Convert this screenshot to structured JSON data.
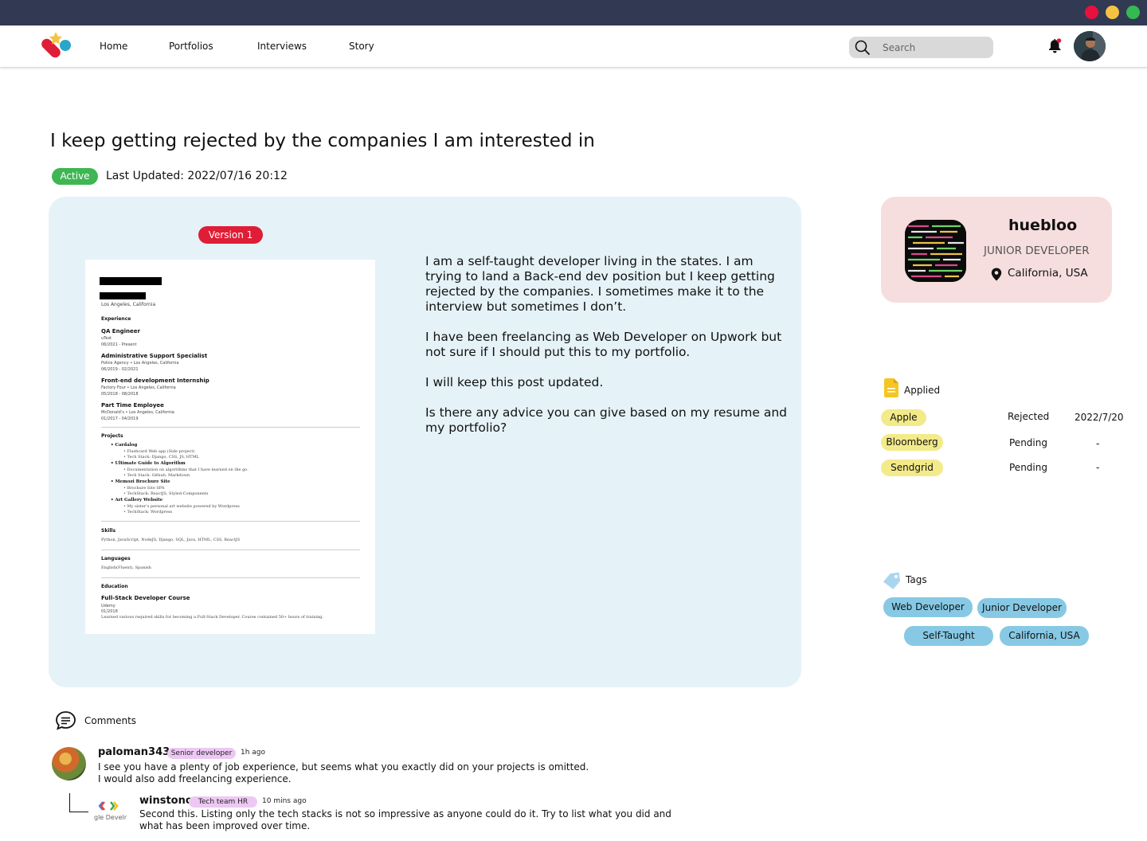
{
  "nav": {
    "links": [
      "Home",
      "Portfolios",
      "Interviews",
      "Story"
    ],
    "search_placeholder": "Search"
  },
  "post": {
    "title": "I keep getting rejected by the companies I am interested in",
    "status": "Active",
    "last_updated": "Last Updated: 2022/07/16 20:12",
    "version_label": "Version 1",
    "body": [
      "I am a self-taught developer living in the states. I am trying to land a Back-end dev position but I keep getting rejected by the companies. I sometimes make it to the interview but sometimes I don’t.",
      "I have been freelancing as Web Developer on Upwork but not sure if I should put this to my portfolio.",
      "I will keep this post updated.",
      "Is there any advice you can give based on my resume and my portfolio?"
    ]
  },
  "resume": {
    "location": "Los Angeles, California",
    "experience_heading": "Experience",
    "jobs": [
      {
        "title": "QA Engineer",
        "company": "uTest",
        "dates": "06/2021 - Present"
      },
      {
        "title": "Administrative Support Specialist",
        "company": "Police Agency • Los Angeles, California",
        "dates": "06/2019 - 02/2021"
      },
      {
        "title": "Front-end development Internship",
        "company": "Factory Four • Los Angeles, California",
        "dates": "05/2018 - 08/2018"
      },
      {
        "title": "Part Time Employee",
        "company": "McDonald’s • Los Angeles, California",
        "dates": "01/2017 - 04/2019"
      }
    ],
    "projects_heading": "Projects",
    "projects": [
      {
        "name": "Cardalog",
        "details": [
          "Flashcard Web app (Side project)",
          "Tech Stack: Django, CSS, JS, HTML"
        ]
      },
      {
        "name": "Ultimate Guide to Algorithm",
        "details": [
          "Documentation on algorithms that I have learned on the go.",
          "Tech Stack: Github, Markdown"
        ]
      },
      {
        "name": "Memozi Brochure Site",
        "details": [
          "Brochure Site SPA",
          "TechStack: ReactJS, Styled-Components"
        ]
      },
      {
        "name": "Art Gallery Website",
        "details": [
          "My sister’s personal art website powered by Wordpress",
          "TechStack: Wordpress"
        ]
      }
    ],
    "skills_heading": "Skills",
    "skills": "Python, JavaScript, NodeJS, Django, SQL, Java, HTML, CSS, ReactJS",
    "languages_heading": "Languages",
    "languages": "English(Fluent), Spanish",
    "education_heading": "Education",
    "course": "Full-Stack Developer Course",
    "school": "Udemy",
    "course_date": "01/2018",
    "course_desc": "Learned various required skills for becoming a Full-Stack Developer. Course contained 50+ hours of training."
  },
  "profile": {
    "name": "huebloo",
    "role": "JUNIOR DEVELOPER",
    "location": "California, USA"
  },
  "applied": {
    "label": "Applied",
    "rows": [
      {
        "company": "Apple",
        "status": "Rejected",
        "date": "2022/7/20"
      },
      {
        "company": "Bloomberg",
        "status": "Pending",
        "date": "-"
      },
      {
        "company": "Sendgrid",
        "status": "Pending",
        "date": "-"
      }
    ]
  },
  "tags": {
    "label": "Tags",
    "items": [
      "Web Developer",
      "Junior Developer",
      "Self-Taught",
      "California, USA"
    ]
  },
  "comments": {
    "label": "Comments",
    "items": [
      {
        "user": "paloman343",
        "role": "Senior developer",
        "time": "1h ago",
        "lines": [
          "I see you have a plenty of job experience, but seems what you exactly did on your projects is omitted.",
          "I would also add freelancing experience."
        ]
      },
      {
        "user": "winstono",
        "role": "Tech team HR",
        "time": "10 mins ago",
        "avatar_text": "gle Develr",
        "lines": [
          "Second this. Listing only the tech stacks is not so impressive as anyone could do it. Try to list what you did and",
          "what has been improved over time."
        ]
      }
    ]
  },
  "colors": {
    "titlebar": "#313a52",
    "active_badge": "#3fb653",
    "version_badge": "#e01d36",
    "card_bg": "#e5f2f8",
    "profile_bg": "#f6dede",
    "company_pill": "#f3ea8a",
    "tag_pill": "#87c9e5",
    "role_pill": "#eec8f4"
  }
}
